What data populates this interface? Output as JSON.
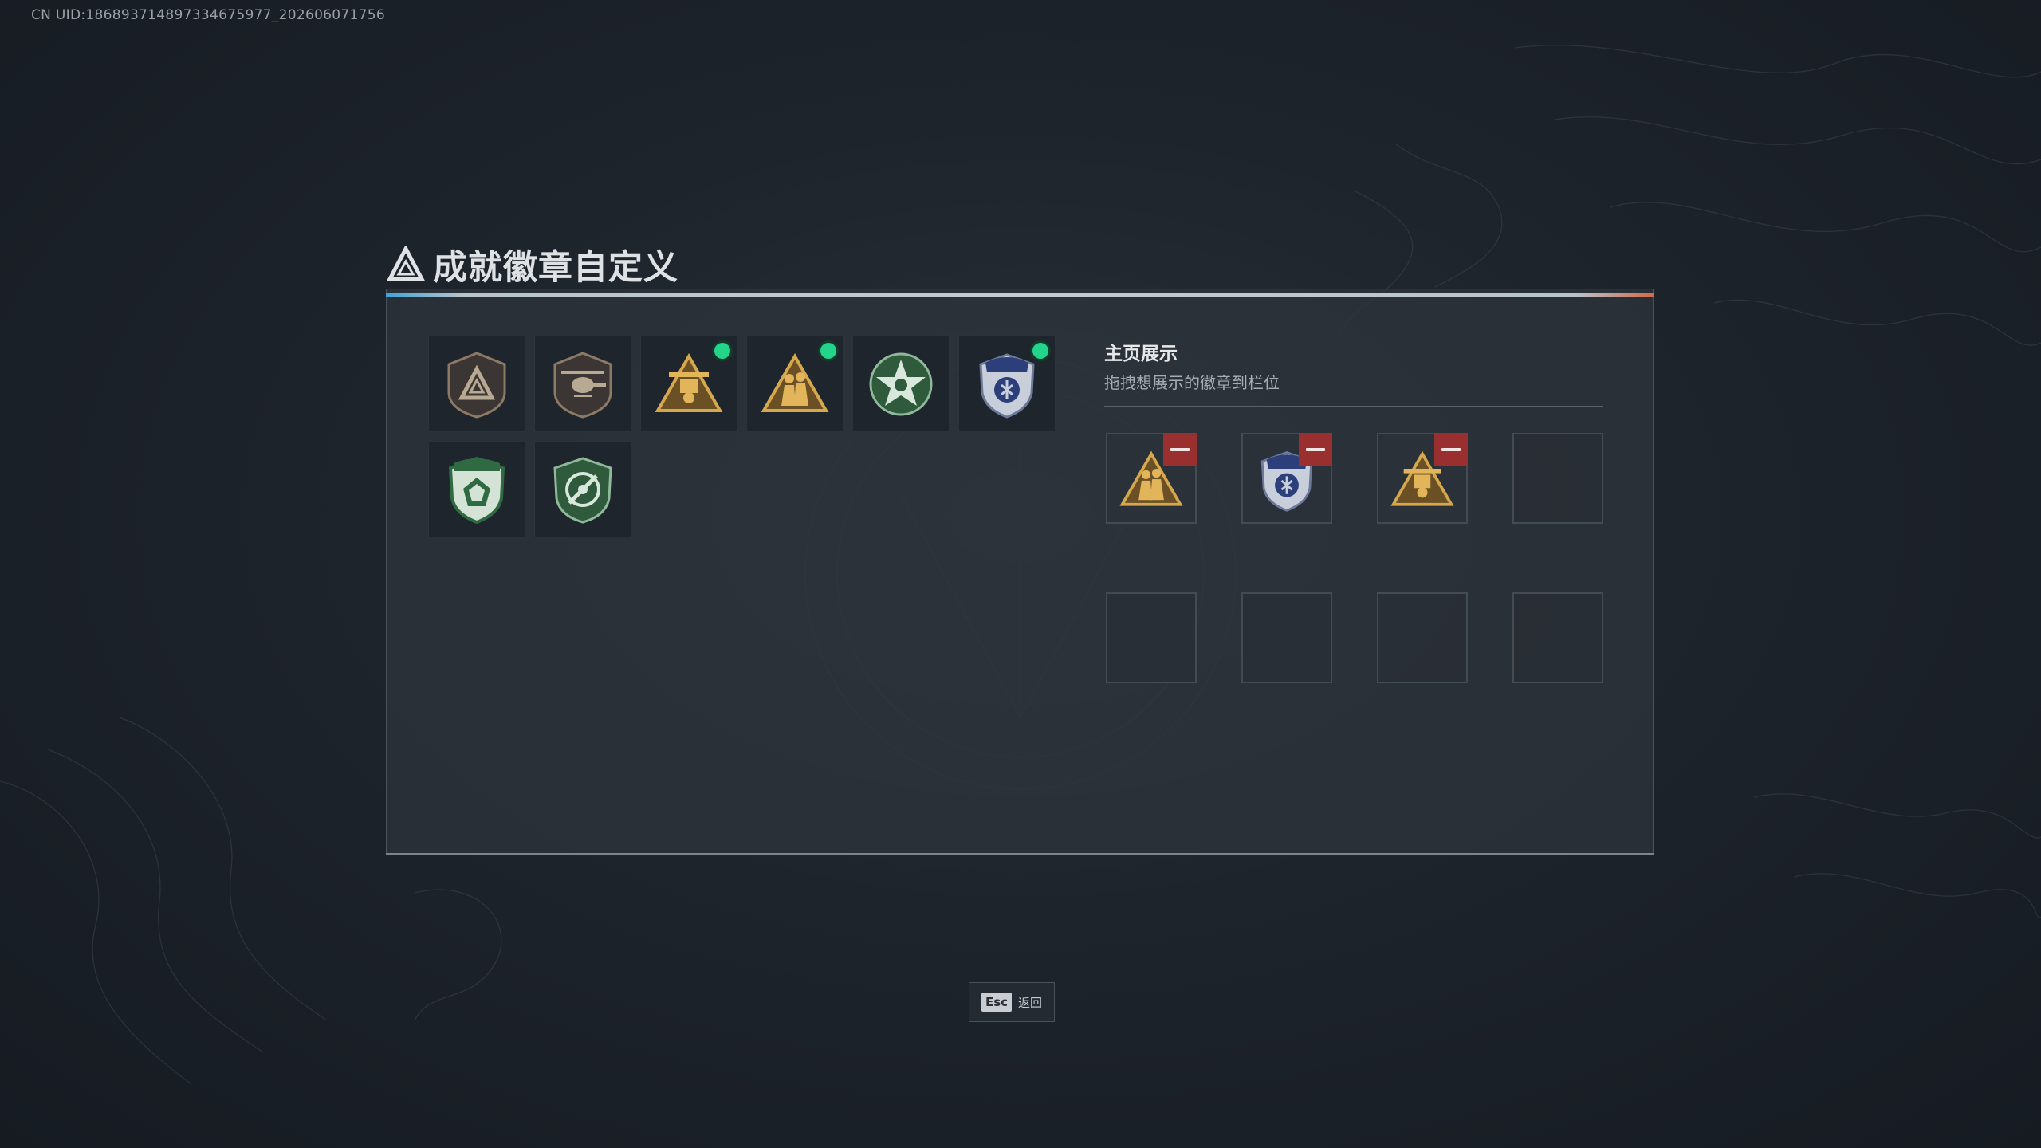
{
  "uid_text": "CN UID:1868937148973346759​77_202606071756",
  "title": "成就徽章自定义",
  "inventory": [
    {
      "icon": "triangle-emblem-badge",
      "new": false
    },
    {
      "icon": "helicopter-badge",
      "new": false
    },
    {
      "icon": "gold-drone-badge",
      "new": true
    },
    {
      "icon": "gold-soldiers-badge",
      "new": true
    },
    {
      "icon": "green-star-badge",
      "new": false
    },
    {
      "icon": "blue-shield-badge",
      "new": true
    },
    {
      "icon": "green-gem-shield-badge",
      "new": false
    },
    {
      "icon": "green-target-badge",
      "new": false
    }
  ],
  "showcase": {
    "title": "主页展示",
    "subtitle": "拖拽想展示的徽章到栏位",
    "slots": [
      {
        "icon": "gold-soldiers-badge"
      },
      {
        "icon": "blue-shield-badge"
      },
      {
        "icon": "gold-drone-badge"
      },
      {
        "icon": ""
      },
      {
        "icon": ""
      },
      {
        "icon": ""
      },
      {
        "icon": ""
      },
      {
        "icon": ""
      }
    ]
  },
  "footer": {
    "esc_key": "Esc",
    "back_label": "返回"
  },
  "colors": {
    "new_dot": "#23d58a",
    "remove": "#9a2f2f",
    "accent_left": "#3fa3d6",
    "accent_right": "#d16a4a"
  }
}
